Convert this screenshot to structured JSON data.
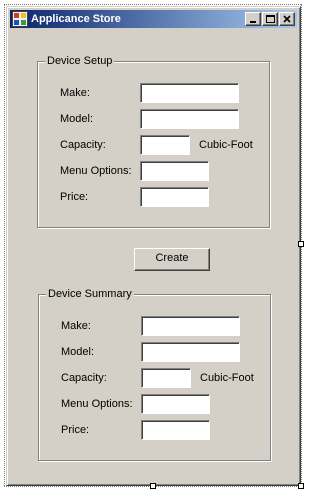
{
  "window": {
    "title": "Applicance Store",
    "titlebar_colors": [
      "#0a246a",
      "#a6caf0"
    ],
    "face_color": "#d4d0c8",
    "icons": {
      "app": "app-icon",
      "minimize": "minimize-icon",
      "maximize": "maximize-icon",
      "close": "close-icon"
    }
  },
  "device_setup": {
    "title": "Device Setup",
    "make_label": "Make:",
    "model_label": "Model:",
    "capacity_label": "Capacity:",
    "capacity_unit": "Cubic-Foot",
    "menu_options_label": "Menu Options:",
    "price_label": "Price:",
    "values": {
      "make": "",
      "model": "",
      "capacity": "",
      "menu_options": "",
      "price": ""
    }
  },
  "create_button": "Create",
  "device_summary": {
    "title": "Device Summary",
    "make_label": "Make:",
    "model_label": "Model:",
    "capacity_label": "Capacity:",
    "capacity_unit": "Cubic-Foot",
    "menu_options_label": "Menu Options:",
    "price_label": "Price:",
    "values": {
      "make": "",
      "model": "",
      "capacity": "",
      "menu_options": "",
      "price": ""
    }
  }
}
